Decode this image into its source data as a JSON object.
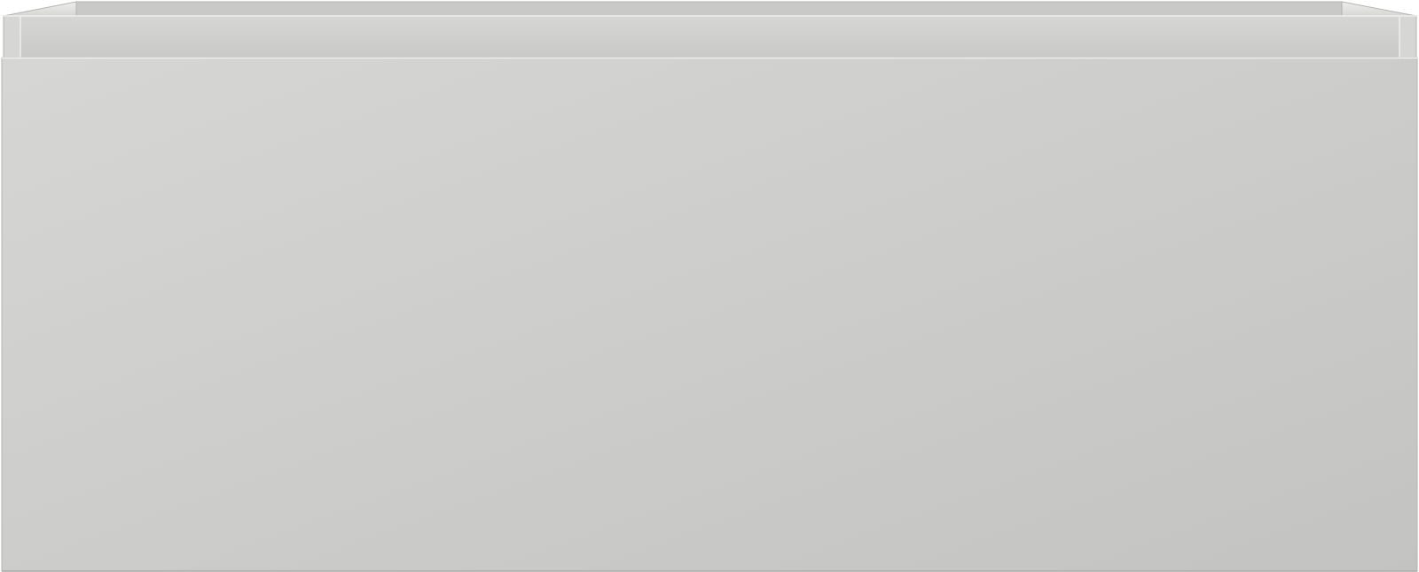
{
  "object": {
    "kind": "drawer",
    "view": "front",
    "text": ""
  },
  "colors": {
    "background": "#ffffff",
    "panel_light": "#d6d6d4",
    "panel_dark": "#c3c3c1",
    "edge_highlight": "#eeeeec",
    "edge_shadow": "#a9a9a7",
    "inner_back": "#c9c9c7",
    "outline": "#b4b4b2"
  }
}
